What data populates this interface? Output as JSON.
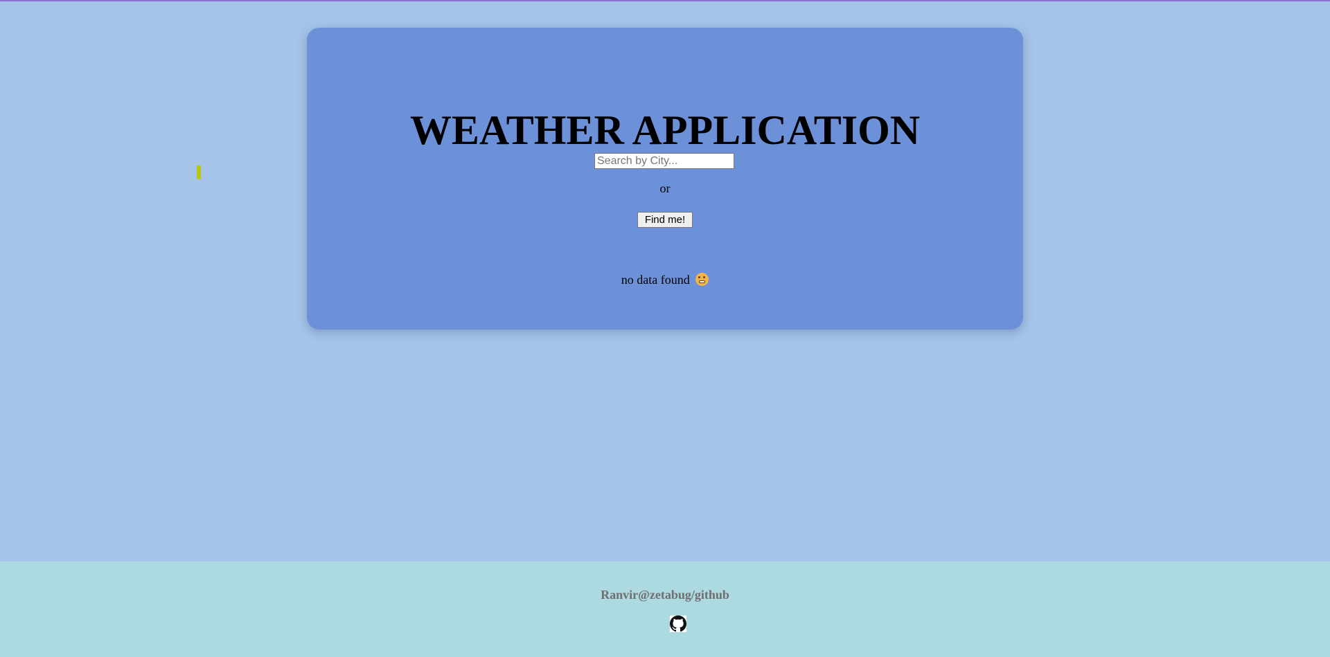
{
  "app": {
    "title": "WEATHER APPLICATION"
  },
  "search": {
    "placeholder": "Search by City...",
    "value": ""
  },
  "separator": "or",
  "find_button": {
    "label": "Find me!"
  },
  "status": {
    "message": "no data found",
    "icon": "grimacing-face-icon"
  },
  "footer": {
    "credit": "Ranvir@zetabug/github",
    "icon": "github-icon"
  },
  "colors": {
    "page_background": "#a5c4e8",
    "card_background": "#6c91d9",
    "footer_background": "#add9e1",
    "footer_text": "#6f6f6f",
    "top_border": "#8a6fd0",
    "marker": "#b5c914"
  }
}
